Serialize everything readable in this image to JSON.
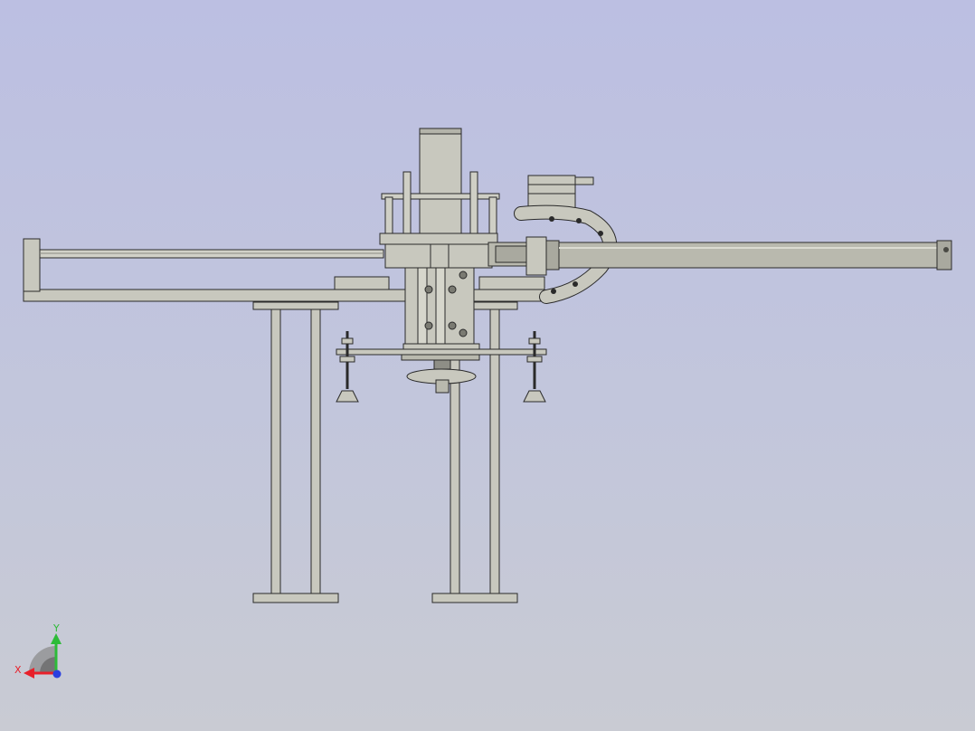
{
  "view": {
    "background_top": "#bcbfe2",
    "background_bottom": "#c9cbd3"
  },
  "model": {
    "part_fill": "#c8c8be",
    "part_fill_dark": "#a9a99f",
    "edge_color": "#2a2a2a",
    "tube_fill": "#b9b9ae"
  },
  "triad": {
    "x_label": "X",
    "y_label": "Y",
    "x_color": "#e8202a",
    "y_color": "#2dbb38",
    "z_color": "#2a3fe0"
  }
}
